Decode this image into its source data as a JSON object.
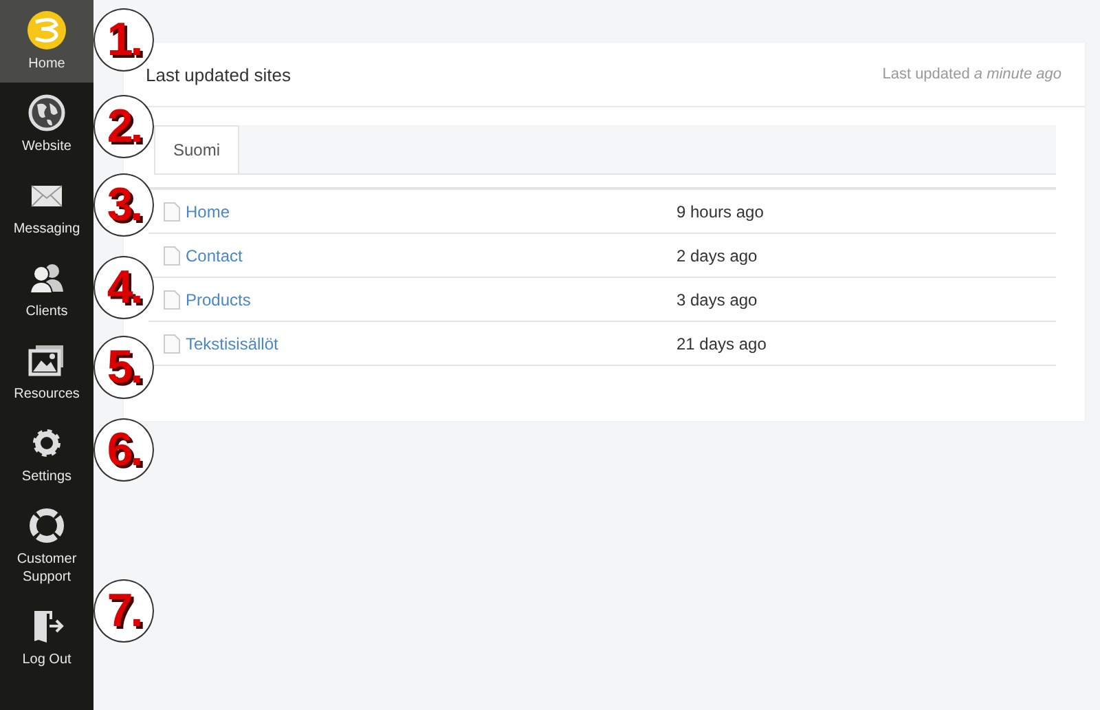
{
  "sidebar": {
    "items": [
      {
        "label": "Home",
        "selected": true
      },
      {
        "label": "Website",
        "selected": false
      },
      {
        "label": "Messaging",
        "selected": false
      },
      {
        "label": "Clients",
        "selected": false
      },
      {
        "label": "Resources",
        "selected": false
      },
      {
        "label": "Settings",
        "selected": false
      },
      {
        "label": "Customer Support",
        "selected": false
      },
      {
        "label": "Log Out",
        "selected": false
      }
    ]
  },
  "card": {
    "title": "Last updated sites",
    "updated": "Last updated *a minute ago*",
    "tabs": [
      {
        "label": "Suomi",
        "selected": true
      }
    ],
    "rows": [
      {
        "page": "Home",
        "time": "9 hours ago"
      },
      {
        "page": "Contact",
        "time": "2 days ago"
      },
      {
        "page": "Products",
        "time": "3 days ago"
      },
      {
        "page": "Tekstisisällöt",
        "time": "21 days ago"
      }
    ]
  },
  "callouts": [
    {
      "label": "1."
    },
    {
      "label": "2."
    },
    {
      "label": "3."
    },
    {
      "label": "4."
    },
    {
      "label": "5."
    },
    {
      "label": "6."
    },
    {
      "label": "7."
    }
  ]
}
